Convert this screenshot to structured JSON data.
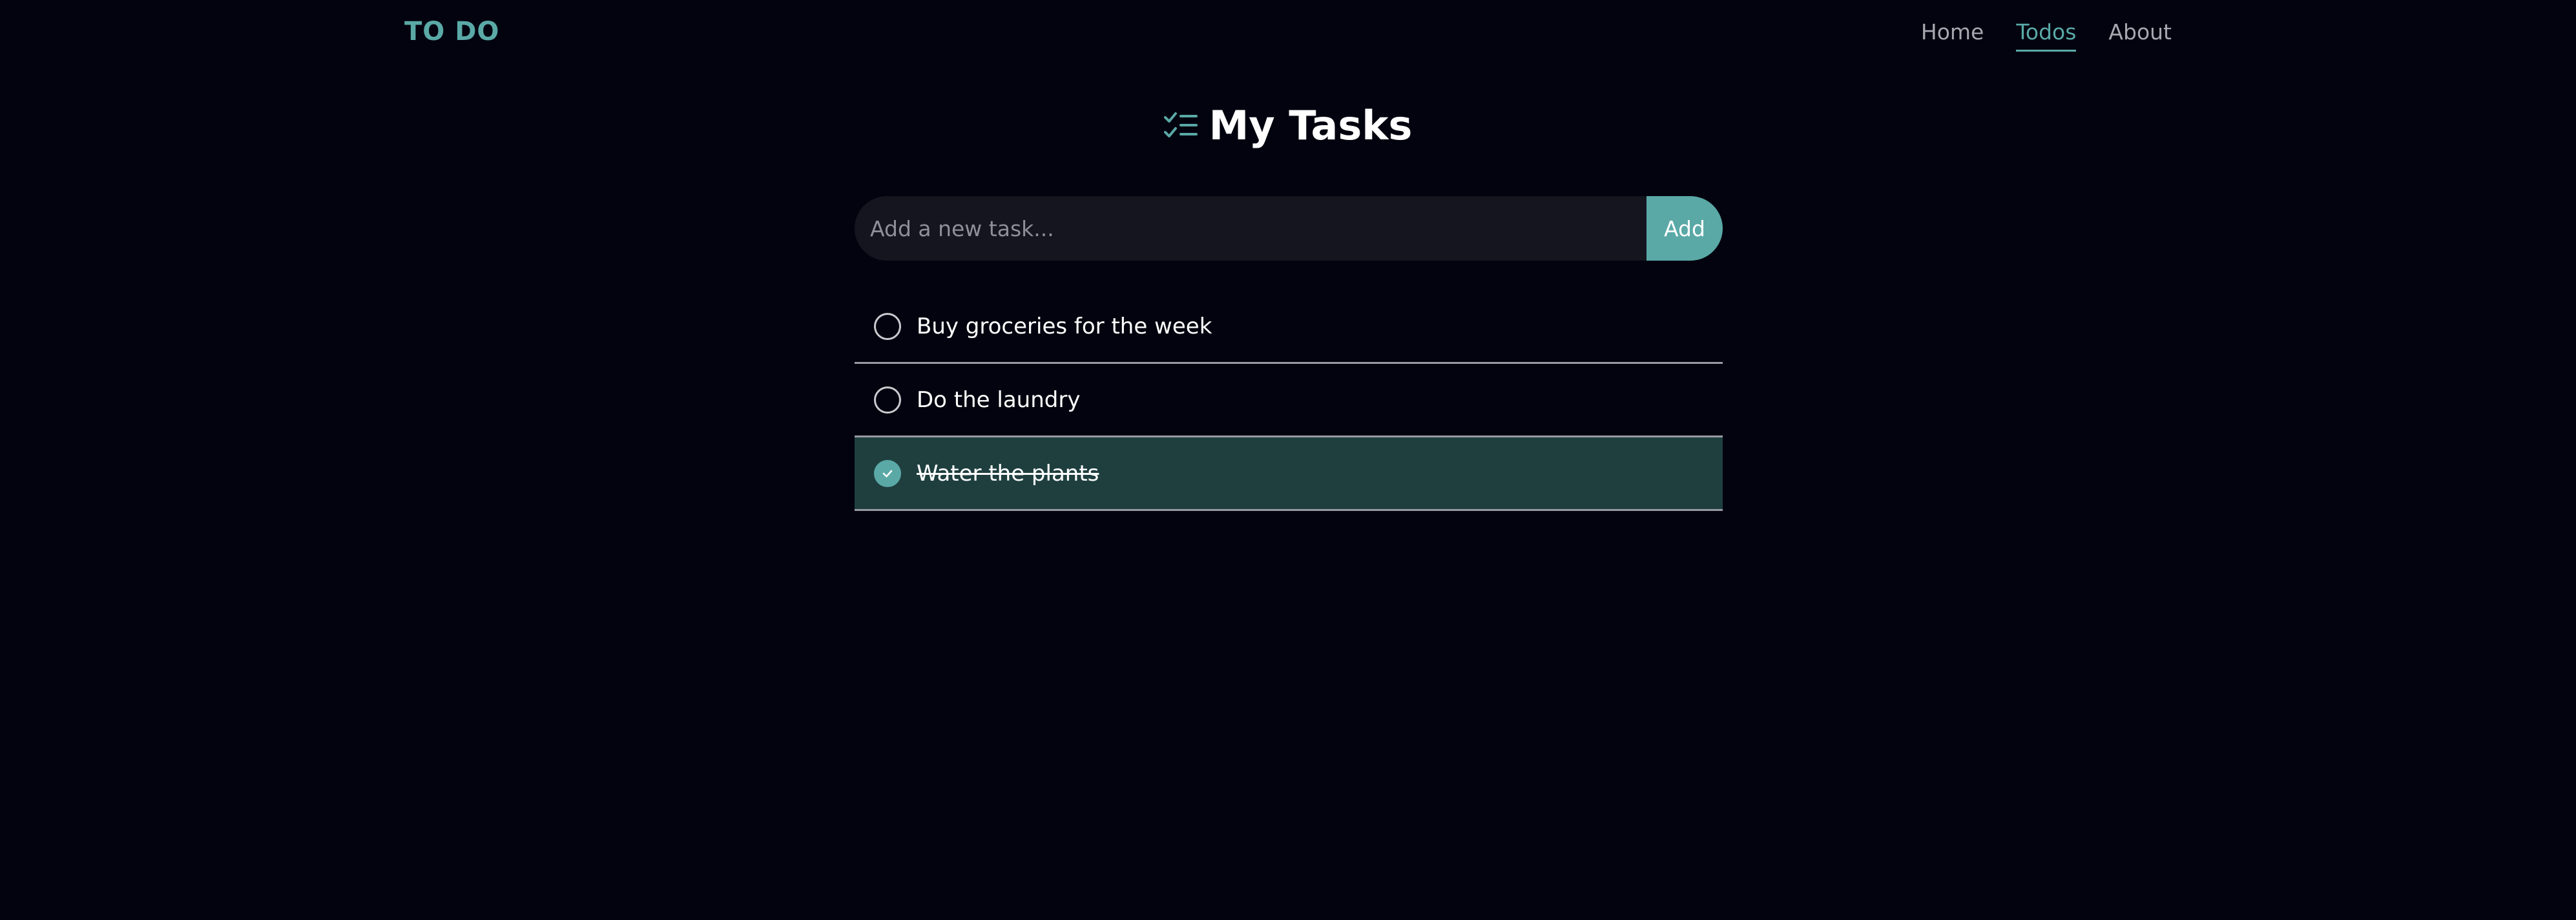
{
  "app": {
    "brand": "TO DO"
  },
  "nav": {
    "items": [
      {
        "label": "Home",
        "active": false
      },
      {
        "label": "Todos",
        "active": true
      },
      {
        "label": "About",
        "active": false
      }
    ]
  },
  "main": {
    "title": "My Tasks",
    "title_icon": "checklist-icon"
  },
  "add_form": {
    "placeholder": "Add a new task...",
    "value": "",
    "button_label": "Add"
  },
  "tasks": [
    {
      "text": "Buy groceries for the week",
      "completed": false
    },
    {
      "text": "Do the laundry",
      "completed": false
    },
    {
      "text": "Water the plants",
      "completed": true
    }
  ],
  "colors": {
    "accent": "#5aa9a7",
    "background": "#03030f",
    "completed_row": "#1f3f3f",
    "input_bg": "#14151f"
  }
}
